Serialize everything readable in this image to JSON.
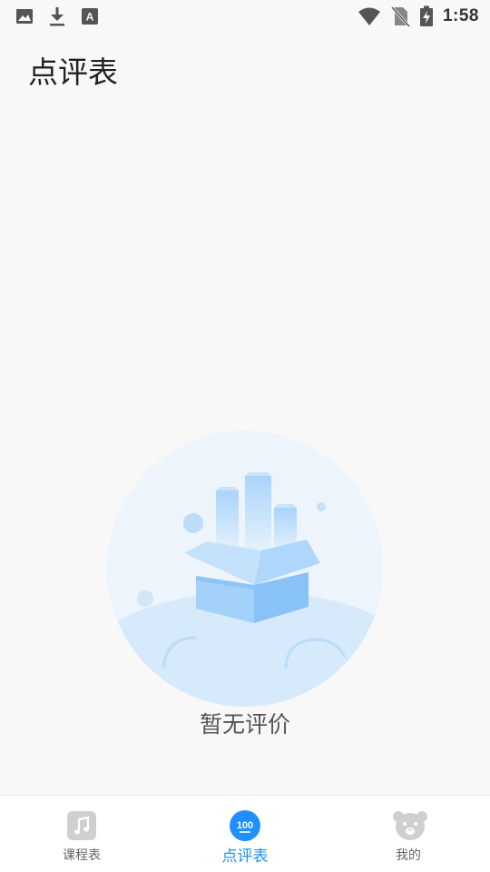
{
  "status_bar": {
    "time": "1:58",
    "left_icons": [
      "image-icon",
      "download-icon",
      "text-icon"
    ],
    "right_icons": [
      "wifi-icon",
      "no-sim-icon",
      "battery-charging-icon"
    ]
  },
  "header": {
    "title": "点评表"
  },
  "empty_state": {
    "message": "暂无评价"
  },
  "tabbar": {
    "tabs": [
      {
        "label": "课程表",
        "icon": "music-note-icon",
        "active": false
      },
      {
        "label": "点评表",
        "icon": "score-100-icon",
        "active": true
      },
      {
        "label": "我的",
        "icon": "bear-icon",
        "active": false
      }
    ]
  },
  "colors": {
    "accent": "#1e90ff",
    "background": "#f8f8f8",
    "tab_inactive": "#666666"
  }
}
